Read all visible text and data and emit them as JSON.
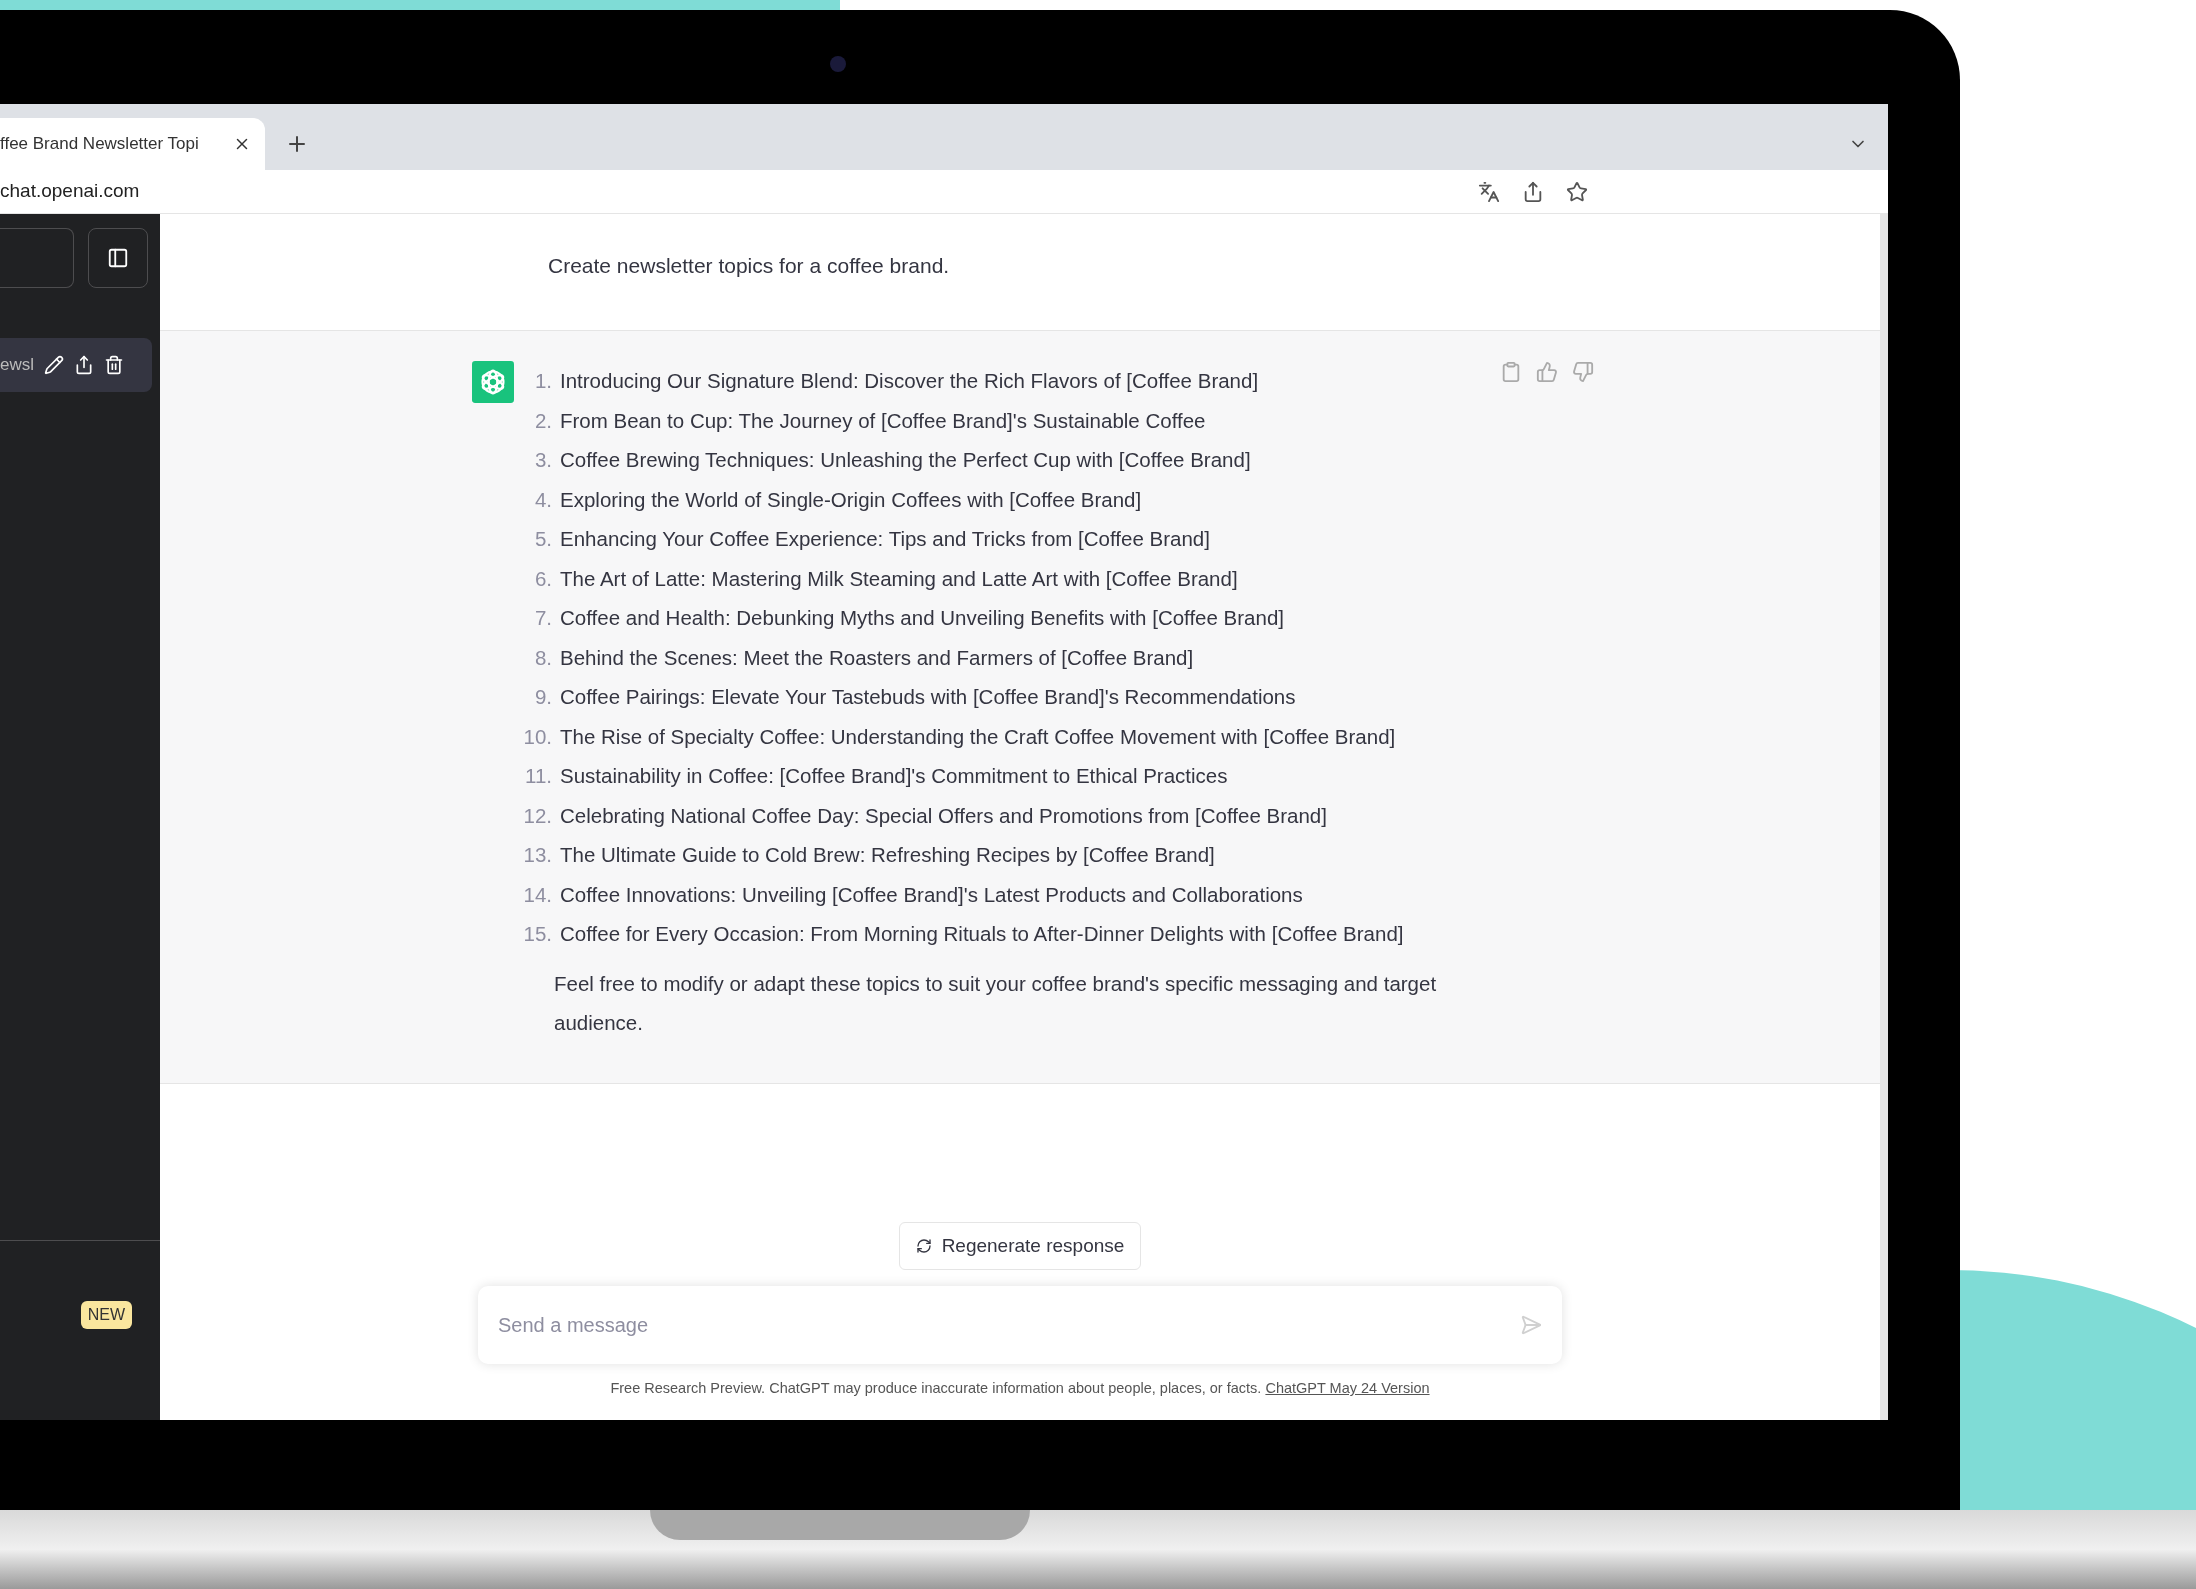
{
  "browser": {
    "tabs": [
      {
        "title": "ffee Brand Newsletter Topi",
        "selected": true
      }
    ],
    "address": "chat.openai.com"
  },
  "sidebar": {
    "chat_items": [
      {
        "title": "ewsl",
        "selected": true
      }
    ],
    "badge": "NEW"
  },
  "conversation": {
    "prompt": "Create newsletter topics for a coffee brand.",
    "response": {
      "items": [
        {
          "number": "1.",
          "text": "Introducing Our Signature Blend: Discover the Rich Flavors of [Coffee Brand]"
        },
        {
          "number": "2.",
          "text": "From Bean to Cup: The Journey of [Coffee Brand]'s Sustainable Coffee"
        },
        {
          "number": "3.",
          "text": "Coffee Brewing Techniques: Unleashing the Perfect Cup with [Coffee Brand]"
        },
        {
          "number": "4.",
          "text": "Exploring the World of Single-Origin Coffees with [Coffee Brand]"
        },
        {
          "number": "5.",
          "text": "Enhancing Your Coffee Experience: Tips and Tricks from [Coffee Brand]"
        },
        {
          "number": "6.",
          "text": "The Art of Latte: Mastering Milk Steaming and Latte Art with [Coffee Brand]"
        },
        {
          "number": "7.",
          "text": "Coffee and Health: Debunking Myths and Unveiling Benefits with [Coffee Brand]"
        },
        {
          "number": "8.",
          "text": "Behind the Scenes: Meet the Roasters and Farmers of [Coffee Brand]"
        },
        {
          "number": "9.",
          "text": "Coffee Pairings: Elevate Your Tastebuds with [Coffee Brand]'s Recommendations"
        },
        {
          "number": "10.",
          "text": "The Rise of Specialty Coffee: Understanding the Craft Coffee Movement with [Coffee Brand]"
        },
        {
          "number": "11.",
          "text": "Sustainability in Coffee: [Coffee Brand]'s Commitment to Ethical Practices"
        },
        {
          "number": "12.",
          "text": "Celebrating National Coffee Day: Special Offers and Promotions from [Coffee Brand]"
        },
        {
          "number": "13.",
          "text": "The Ultimate Guide to Cold Brew: Refreshing Recipes by [Coffee Brand]"
        },
        {
          "number": "14.",
          "text": "Coffee Innovations: Unveiling [Coffee Brand]'s Latest Products and Collaborations"
        },
        {
          "number": "15.",
          "text": "Coffee for Every Occasion: From Morning Rituals to After-Dinner Delights with [Coffee Brand]"
        }
      ],
      "closing": "Feel free to modify or adapt these topics to suit your coffee brand's specific messaging and target audience."
    }
  },
  "regenerate_button": "Regenerate response",
  "composer": {
    "placeholder": "Send a message"
  },
  "footer": {
    "text": "Free Research Preview. ChatGPT may produce inaccurate information about people, places, or facts.",
    "link": "ChatGPT May 24 Version"
  }
}
